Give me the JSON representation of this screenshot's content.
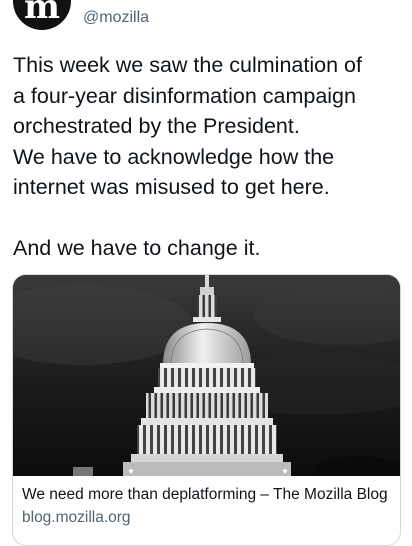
{
  "account": {
    "avatar_icon": "mozilla-logo-icon",
    "avatar_letter": "m",
    "handle": "@mozilla"
  },
  "tweet": {
    "lines": [
      "This week we saw the culmination of",
      "a four-year disinformation campaign",
      "orchestrated by the President.",
      "We have to acknowledge how the",
      "internet was misused to get here.",
      "And we have to change it."
    ]
  },
  "link_card": {
    "image_icon": "capitol-dome-photo",
    "title": "We need more than deplatforming – The Mozilla Blog",
    "domain": "blog.mozilla.org"
  }
}
